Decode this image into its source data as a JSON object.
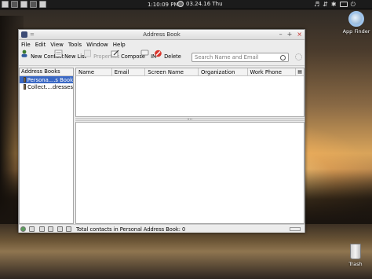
{
  "top_panel": {
    "clock": "1:10:09 PM",
    "date": "03.24.16 Thu"
  },
  "desktop": {
    "app_finder_label": "App Finder",
    "trash_label": "Trash"
  },
  "window": {
    "title": "Address Book",
    "title_small": "=",
    "buttons": {
      "minimize": "–",
      "maximize": "+",
      "close": "×"
    }
  },
  "menu": {
    "file": "File",
    "edit": "Edit",
    "view": "View",
    "tools": "Tools",
    "window": "Window",
    "help": "Help"
  },
  "toolbar": {
    "new_contact": "New Contact",
    "new_list": "New List",
    "properties": "Properties",
    "compose": "Compose",
    "im": "IM",
    "delete": "Delete",
    "search_placeholder": "Search Name and Email"
  },
  "address_books": {
    "header": "Address Books",
    "items": [
      {
        "label": "Persona....s Book",
        "selected": true
      },
      {
        "label": "Collect....dresses",
        "selected": false
      }
    ]
  },
  "contact_list": {
    "columns": [
      "Name",
      "Email",
      "Screen Name",
      "Organization",
      "Work Phone"
    ]
  },
  "status": {
    "text": "Total contacts in Personal Address Book: 0"
  },
  "colors": {
    "selection": "#3a68c4",
    "close_button": "#c8302b",
    "delete_icon": "#d9342b"
  }
}
